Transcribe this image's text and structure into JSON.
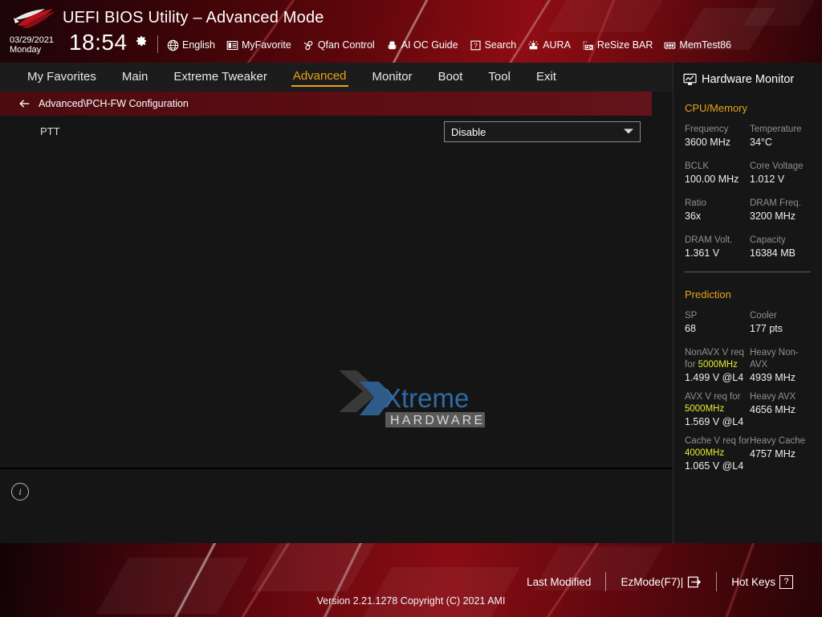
{
  "header": {
    "title": "UEFI BIOS Utility – Advanced Mode",
    "logo_name": "rog-logo",
    "date": "03/29/2021",
    "weekday": "Monday",
    "time": "18:54",
    "gear_icon": "gear-icon",
    "toolbar": [
      {
        "label": "English",
        "icon": "globe-icon"
      },
      {
        "label": "MyFavorite",
        "icon": "list-star-icon"
      },
      {
        "label": "Qfan Control",
        "icon": "fan-icon"
      },
      {
        "label": "AI OC Guide",
        "icon": "chip-brain-icon"
      },
      {
        "label": "Search",
        "icon": "question-box-icon"
      },
      {
        "label": "AURA",
        "icon": "aura-light-icon"
      },
      {
        "label": "ReSize BAR",
        "icon": "gpu-card-icon"
      },
      {
        "label": "MemTest86",
        "icon": "memory-module-icon"
      }
    ]
  },
  "nav": {
    "tabs": [
      {
        "label": "My Favorites",
        "active": false
      },
      {
        "label": "Main",
        "active": false
      },
      {
        "label": "Extreme Tweaker",
        "active": false
      },
      {
        "label": "Advanced",
        "active": true
      },
      {
        "label": "Monitor",
        "active": false
      },
      {
        "label": "Boot",
        "active": false
      },
      {
        "label": "Tool",
        "active": false
      },
      {
        "label": "Exit",
        "active": false
      }
    ],
    "active_color": "#e8a317"
  },
  "main": {
    "breadcrumb": "Advanced\\PCH-FW Configuration",
    "back_icon": "back-arrow-icon",
    "settings": [
      {
        "label": "PTT",
        "value": "Disable",
        "control": "dropdown"
      }
    ],
    "watermark": {
      "primary": "Xtreme",
      "secondary": "HARDWARE"
    },
    "info_icon": "info-icon"
  },
  "sidebar": {
    "title": "Hardware Monitor",
    "title_icon": "monitor-chart-icon",
    "sections": [
      {
        "name": "CPU/Memory",
        "pairs": [
          {
            "left_key": "Frequency",
            "left_val": "3600 MHz",
            "right_key": "Temperature",
            "right_val": "34°C"
          },
          {
            "left_key": "BCLK",
            "left_val": "100.00 MHz",
            "right_key": "Core Voltage",
            "right_val": "1.012 V"
          },
          {
            "left_key": "Ratio",
            "left_val": "36x",
            "right_key": "DRAM Freq.",
            "right_val": "3200 MHz"
          },
          {
            "left_key": "DRAM Volt.",
            "left_val": "1.361 V",
            "right_key": "Capacity",
            "right_val": "16384 MB"
          }
        ]
      },
      {
        "name": "Prediction",
        "pairs": [
          {
            "left_key": "SP",
            "left_val": "68",
            "right_key": "Cooler",
            "right_val": "177 pts"
          }
        ],
        "predictions": [
          {
            "left_key_pre": "NonAVX V req for ",
            "left_key_hz": "5000MHz",
            "left_key_post": "",
            "left_val": "1.499 V @L4",
            "right_key": "Heavy Non-AVX",
            "right_val": "4939 MHz"
          },
          {
            "left_key_pre": "AVX V req   for ",
            "left_key_hz": "5000MHz",
            "left_key_post": "",
            "left_val": "1.569 V @L4",
            "right_key": "Heavy AVX",
            "right_val": "4656 MHz"
          },
          {
            "left_key_pre": "Cache V req for ",
            "left_key_hz": "4000MHz",
            "left_key_post": "",
            "left_val": "1.065 V @L4",
            "right_key": "Heavy Cache",
            "right_val": "4757 MHz"
          }
        ]
      }
    ],
    "accent_color": "#e8a317",
    "highlight_color": "#e8ec2a"
  },
  "footer": {
    "last_modified": "Last Modified",
    "ezmode": "EzMode(F7)|",
    "ezmode_icon": "exit-arrow-icon",
    "hotkeys": "Hot Keys",
    "hotkeys_key": "?",
    "version": "Version 2.21.1278 Copyright (C) 2021 AMI"
  }
}
